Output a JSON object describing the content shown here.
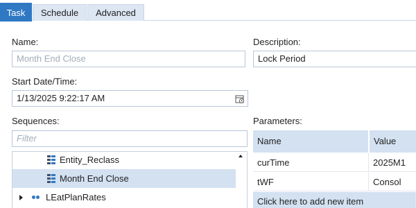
{
  "tabs": [
    {
      "label": "Task",
      "active": true
    },
    {
      "label": "Schedule",
      "active": false
    },
    {
      "label": "Advanced",
      "active": false
    }
  ],
  "form": {
    "name_label": "Name:",
    "name_placeholder": "Month End Close",
    "description_label": "Description:",
    "description_value": "Lock Period",
    "start_label": "Start Date/Time:",
    "start_value": "1/13/2025 9:22:17 AM",
    "sequences_label": "Sequences:",
    "filter_placeholder": "Filter",
    "parameters_label": "Parameters:"
  },
  "sequences": [
    {
      "label": "Entity_Reclass",
      "selected": false,
      "icon": "sequence-icon"
    },
    {
      "label": "Month End Close",
      "selected": true,
      "icon": "sequence-icon"
    },
    {
      "label": "LEatPlanRates",
      "selected": false,
      "icon": "folder-dots-icon"
    }
  ],
  "parameters": {
    "columns": [
      "Name",
      "Value"
    ],
    "rows": [
      [
        "curTime",
        "2025M1"
      ],
      [
        "tWF",
        "Consol"
      ]
    ],
    "add_row": "Click here to add new item"
  },
  "colors": {
    "accent": "#2f78c4",
    "header_bg": "#d3e1f1"
  }
}
